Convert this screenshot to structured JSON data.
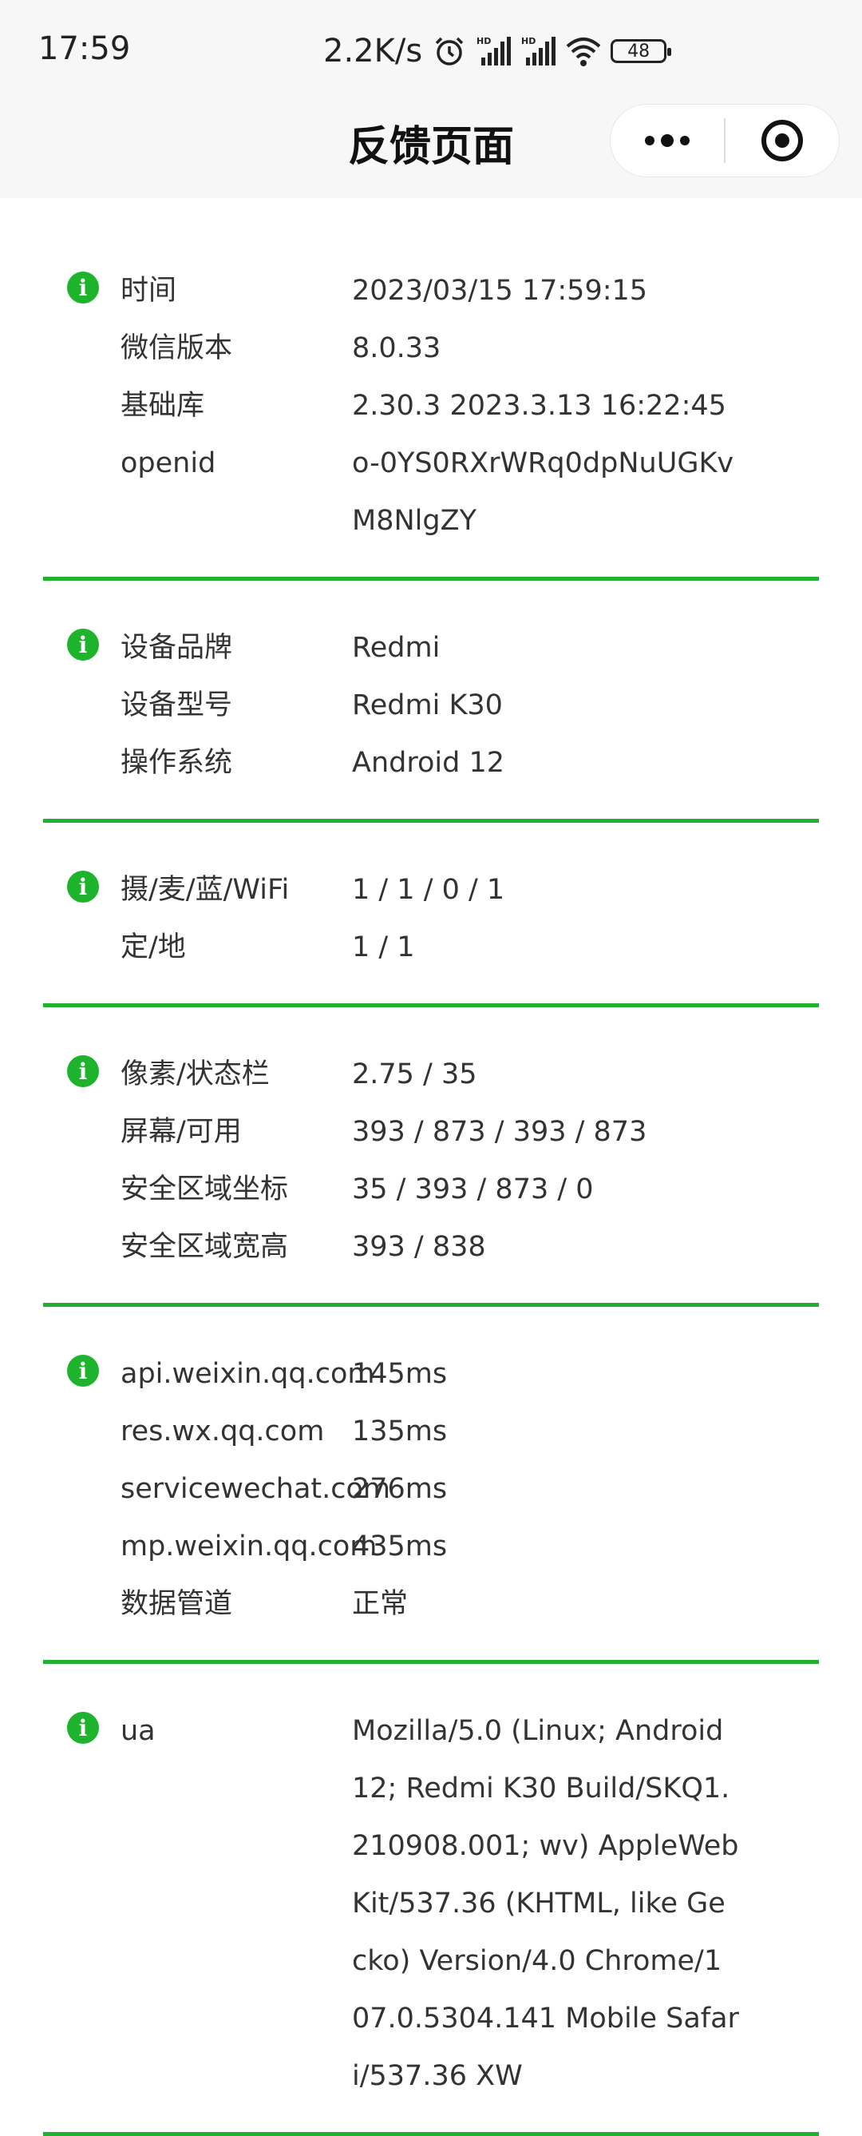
{
  "status_bar": {
    "time": "17:59",
    "net_speed": "2.2K/s",
    "icons": [
      "alarm-icon",
      "hd-signal-icon",
      "hd-signal-icon",
      "wifi-icon"
    ],
    "battery": "48"
  },
  "nav": {
    "title": "反馈页面",
    "more_icon": "more-dots-icon",
    "close_icon": "target-close-icon"
  },
  "sections": [
    {
      "rows": [
        {
          "label": "时间",
          "value": "2023/03/15 17:59:15"
        },
        {
          "label": "微信版本",
          "value": "8.0.33"
        },
        {
          "label": "基础库",
          "value": "2.30.3 2023.3.13 16:22:45"
        },
        {
          "label": "openid",
          "value": "o-0YS0RXrWRq0dpNuUGKvM8NlgZY"
        }
      ]
    },
    {
      "rows": [
        {
          "label": "设备品牌",
          "value": "Redmi"
        },
        {
          "label": "设备型号",
          "value": "Redmi K30"
        },
        {
          "label": "操作系统",
          "value": "Android 12"
        }
      ]
    },
    {
      "rows": [
        {
          "label": "摄/麦/蓝/WiFi",
          "value": "1 / 1 / 0 / 1"
        },
        {
          "label": "定/地",
          "value": "1 / 1"
        }
      ]
    },
    {
      "rows": [
        {
          "label": "像素/状态栏",
          "value": "2.75 / 35"
        },
        {
          "label": "屏幕/可用",
          "value": "393 / 873 / 393 / 873"
        },
        {
          "label": "安全区域坐标",
          "value": "35 / 393 / 873 / 0"
        },
        {
          "label": "安全区域宽高",
          "value": "393 / 838"
        }
      ]
    },
    {
      "rows": [
        {
          "label": "api.weixin.qq.com",
          "value": "145ms"
        },
        {
          "label": "res.wx.qq.com",
          "value": "135ms"
        },
        {
          "label": "servicewechat.com",
          "value": "276ms"
        },
        {
          "label": "mp.weixin.qq.com",
          "value": "435ms"
        },
        {
          "label": "数据管道",
          "value": "正常"
        }
      ]
    },
    {
      "rows": [
        {
          "label": "ua",
          "value": "Mozilla/5.0 (Linux; Android 12; Redmi K30 Build/SKQ1.210908.001; wv) AppleWebKit/537.36 (KHTML, like Gecko) Version/4.0 Chrome/107.0.5304.141 Mobile Safari/537.36 XW"
        }
      ]
    }
  ],
  "colors": {
    "accent": "#22b033",
    "info_icon": "#1db32c",
    "bar_bg": "#f7f7f7"
  }
}
